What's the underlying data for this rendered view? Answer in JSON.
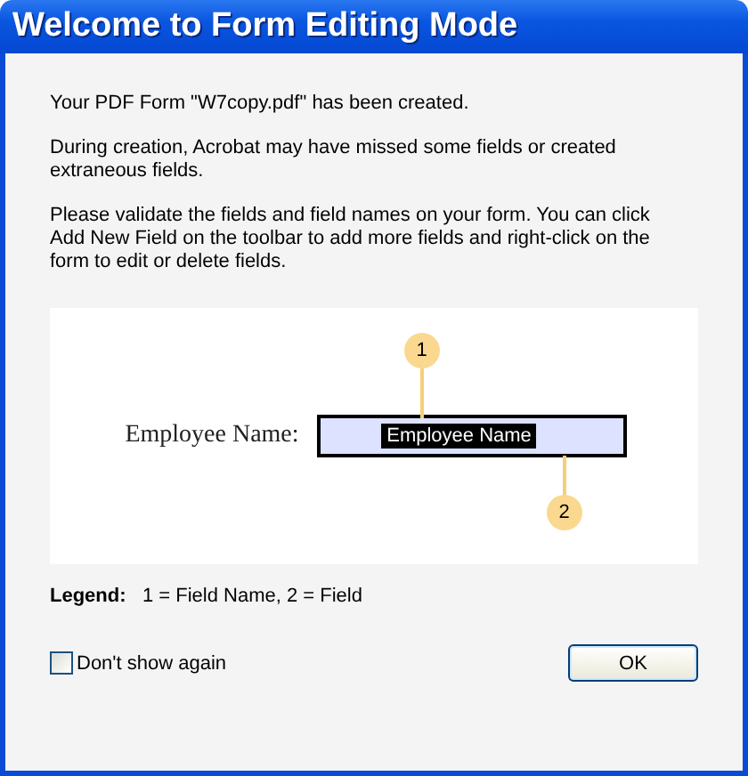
{
  "window": {
    "title": "Welcome to Form Editing Mode"
  },
  "paragraphs": [
    "Your PDF Form \"W7copy.pdf\" has been created.",
    "During creation, Acrobat may have missed some fields or created extraneous fields.",
    "Please validate the fields and field names on your form. You can click Add New Field on the toolbar to add more fields and right-click on the form to edit or delete fields."
  ],
  "illustration": {
    "label": "Employee Name:",
    "field_name": "Employee Name",
    "callouts": [
      "1",
      "2"
    ]
  },
  "legend": "**Legend:**   1 = Field Name, 2 = Field",
  "dont_show_again": {
    "label": "Don't show again",
    "checked": false
  },
  "buttons": [
    "OK"
  ]
}
